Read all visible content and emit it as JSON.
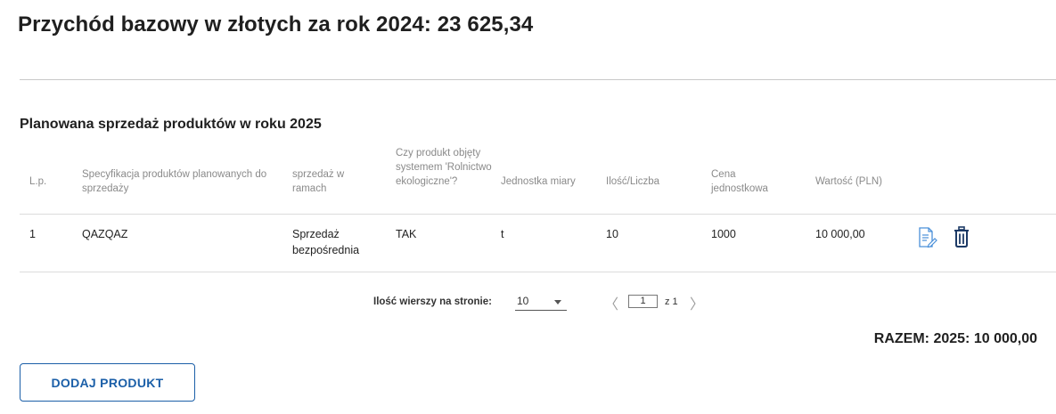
{
  "header": {
    "title": "Przychód bazowy w złotych za rok 2024: 23 625,34"
  },
  "section": {
    "title": "Planowana sprzedaż produktów w roku 2025"
  },
  "table": {
    "columns": [
      "L.p.",
      "Specyfikacja produktów planowanych do sprzedaży",
      "sprzedaż w ramach",
      "Czy produkt objęty systemem 'Rolnictwo ekologiczne'?",
      "Jednostka miary",
      "Ilość/Liczba",
      "Cena jednostkowa",
      "Wartość (PLN)"
    ],
    "rows": [
      {
        "lp": "1",
        "spec": "QAZQAZ",
        "sale_type": "Sprzedaż bezpośrednia",
        "eco": "TAK",
        "unit": "t",
        "qty": "10",
        "price": "1000",
        "value": "10 000,00",
        "actions": [
          "edit-icon",
          "trash-icon"
        ]
      }
    ]
  },
  "pagination": {
    "rows_label": "Ilość wierszy na stronie:",
    "rows_per_page": "10",
    "current_page": "1",
    "of_label": "z 1"
  },
  "summary": {
    "total": "RAZEM: 2025: 10 000,00"
  },
  "actions": {
    "add_product": "DODAJ PRODUKT"
  },
  "colors": {
    "accent": "#1b5fa8",
    "edit_icon": "#4a90d9",
    "trash_icon": "#1d3a66"
  }
}
